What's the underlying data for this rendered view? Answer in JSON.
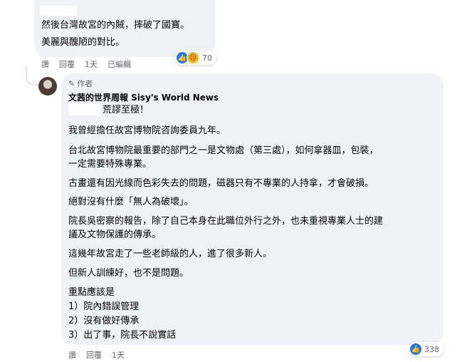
{
  "comment1": {
    "lines": [
      "然後台灣故宮的內賊，摔破了國寶。",
      "美麗與醜陋的對比。"
    ],
    "reaction_count": "70",
    "actions": {
      "like": "讚",
      "reply": "回覆",
      "time": "1天",
      "edited": "已編輯"
    }
  },
  "reply": {
    "author_badge": "作者",
    "page_name": "文茜的世界周報 Sisy's World News",
    "lines": [
      "荒謬至極！",
      "我曾經擔任故宮博物院咨詢委員九年。",
      "台北故宮博物院最重要的部門之一是文物處（第三處），如何拿器皿，包裝，",
      "一定需要特殊專業。",
      "古畫還有因光線而色彩失去的問題，磁器只有不專業的人持拿，才會破損。",
      "絕對沒有什麼「無人為破壞」。",
      "院長吳密察的報告，除了自己本身在此職位外行之外，也未重視專業人士的建",
      "議及文物保護的傳承。",
      "這幾年故宮走了一些老師級的人，進了很多新人。",
      "但新人訓練好，也不是問題。",
      "重點應該是",
      "1）院內錯誤管理",
      "2）沒有做好傳承",
      "3）出了事，院長不說實話"
    ],
    "reaction_count": "338",
    "actions": {
      "like": "讚",
      "reply": "回覆",
      "time": "1天"
    }
  },
  "icons": {
    "like": "like-icon",
    "sad": "sad-icon",
    "pen": "pen-icon"
  },
  "colors": {
    "bubble": "#f0f2f5",
    "meta": "#65676b",
    "like_blue": "#1877f2"
  }
}
